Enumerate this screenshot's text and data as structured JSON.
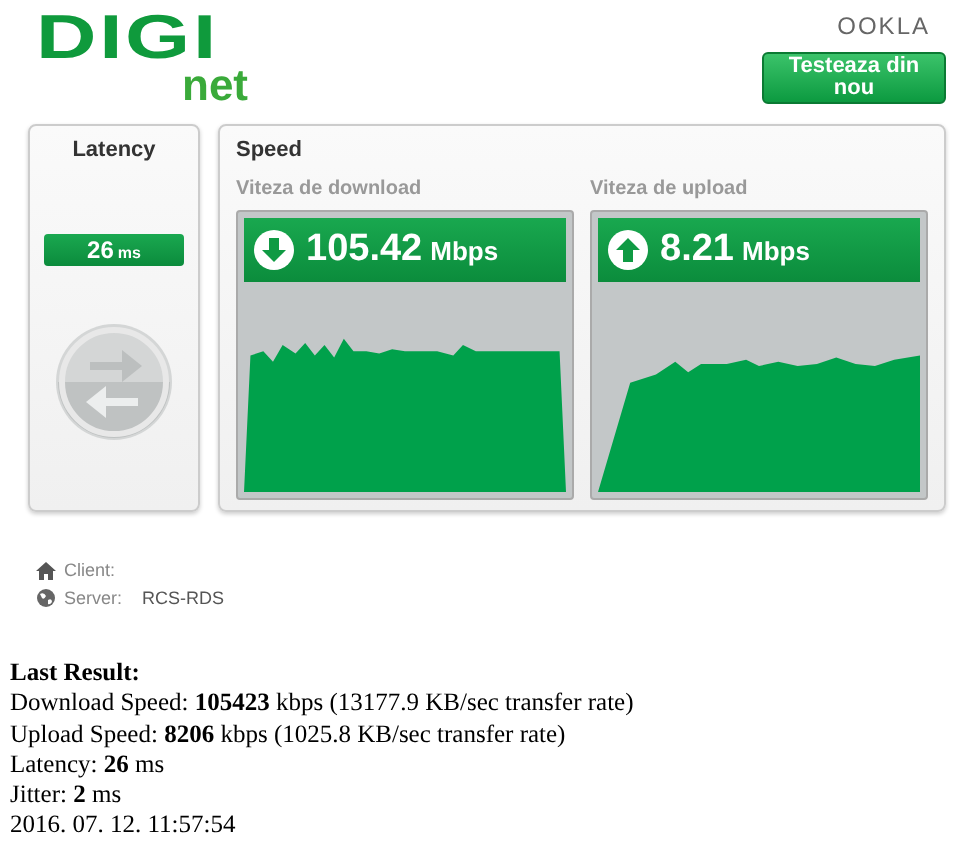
{
  "header": {
    "logo": {
      "main": "DIGI",
      "sub": "net"
    },
    "brand": "OOKLA",
    "retest_button": "Testeaza din nou"
  },
  "latency": {
    "title": "Latency",
    "value": "26",
    "unit": "ms"
  },
  "speed": {
    "title": "Speed",
    "tests": [
      {
        "kind": "download",
        "label": "Viteza de download",
        "value": "105.42",
        "unit": "Mbps"
      },
      {
        "kind": "upload",
        "label": "Viteza de upload",
        "value": "8.21",
        "unit": "Mbps"
      }
    ]
  },
  "info": [
    {
      "kind": "client",
      "label": "Client:"
    },
    {
      "kind": "server",
      "label": "Server:",
      "value": "RCS-RDS"
    }
  ],
  "last_result": {
    "title": "Last Result:",
    "lines": [
      "Download Speed: **105423** kbps (13177.9 KB/sec transfer rate)",
      "Upload Speed: **8206** kbps (1025.8 KB/sec transfer rate)",
      "Latency: **26** ms",
      "Jitter: **2** ms",
      "2016. 07. 12. 11:57:54"
    ]
  }
}
